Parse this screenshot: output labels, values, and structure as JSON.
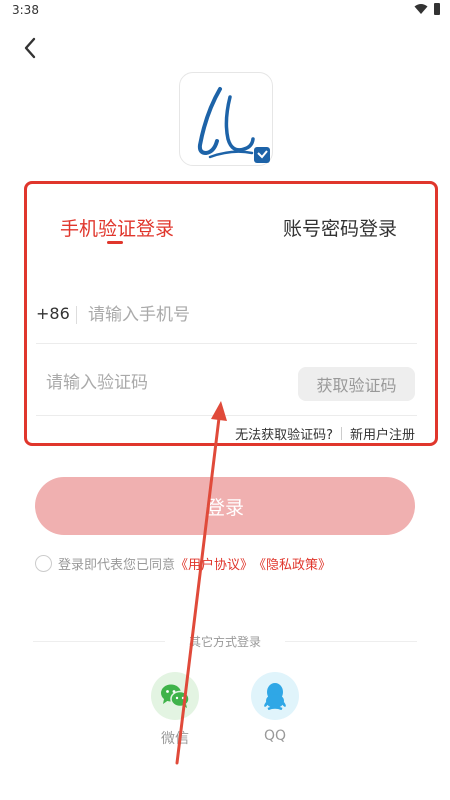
{
  "status_bar": {
    "time": "3:38"
  },
  "tabs": [
    {
      "label": "手机验证登录",
      "active": true
    },
    {
      "label": "账号密码登录",
      "active": false
    }
  ],
  "phone": {
    "country_code": "+86",
    "placeholder": "请输入手机号",
    "value": ""
  },
  "code": {
    "placeholder": "请输入验证码",
    "value": "",
    "get_code_label": "获取验证码"
  },
  "help": {
    "cant_get_code": "无法获取验证码?",
    "register": "新用户注册"
  },
  "login_button": "登录",
  "agreement": {
    "prefix": "登录即代表您已同意",
    "user_agreement": "《用户协议》",
    "privacy_policy": "《隐私政策》",
    "checked": false
  },
  "other_login": {
    "title": "其它方式登录",
    "options": [
      {
        "label": "微信",
        "icon": "wechat-icon"
      },
      {
        "label": "QQ",
        "icon": "qq-icon"
      }
    ]
  },
  "colors": {
    "accent": "#e0362c",
    "login_button_disabled": "#f0b0b0",
    "annotation": "#e04a3a"
  }
}
